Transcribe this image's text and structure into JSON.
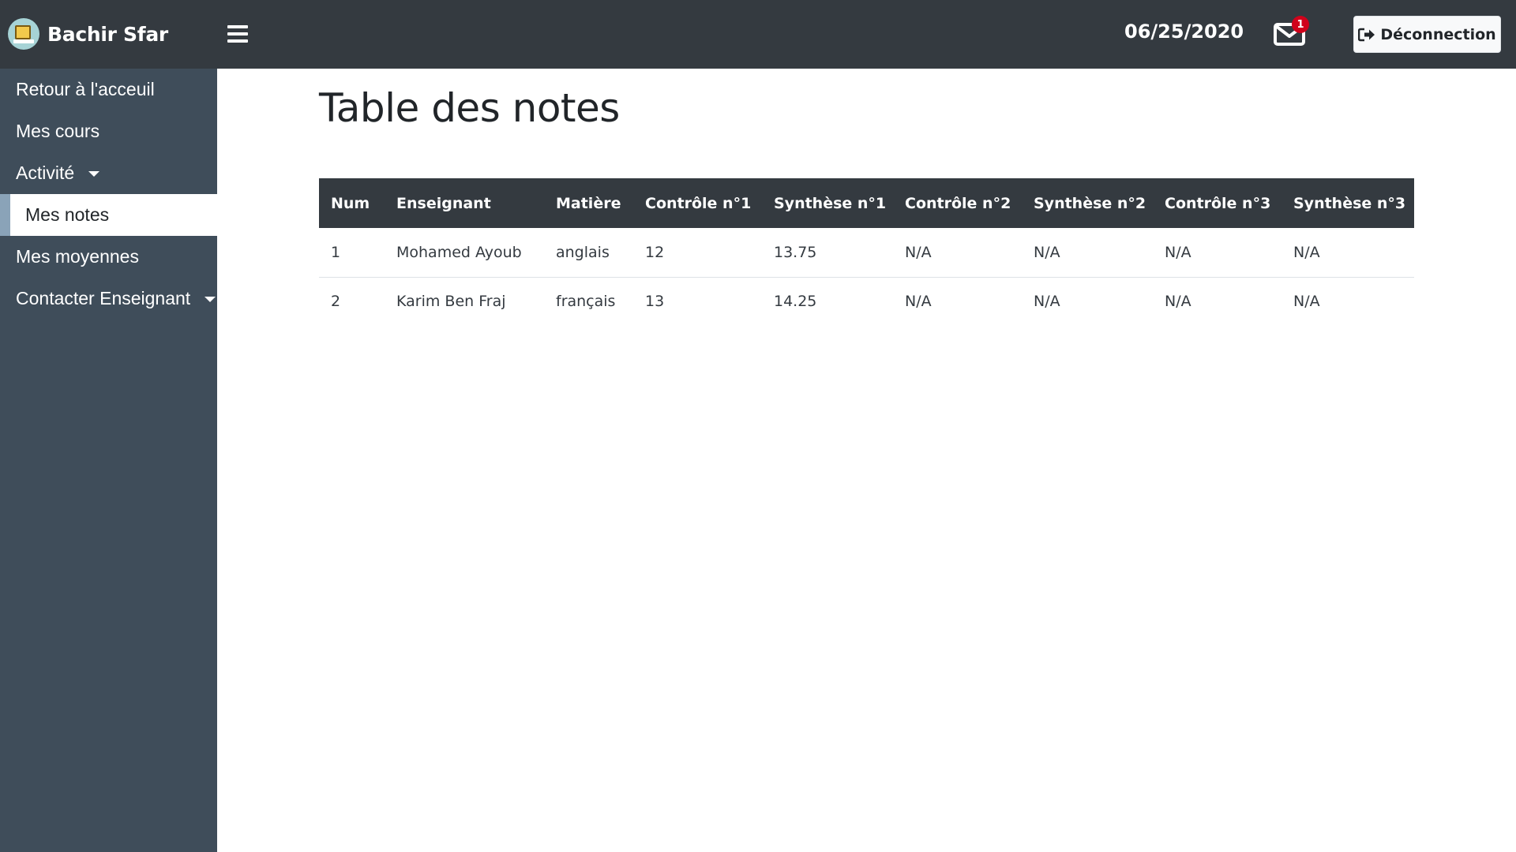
{
  "navbar": {
    "brand_name": "Bachir Sfar",
    "date": "06/25/2020",
    "unread_count": "1",
    "logout_label": "Déconnection"
  },
  "sidebar": {
    "items": [
      {
        "label": "Retour à l'acceuil"
      },
      {
        "label": "Mes cours"
      },
      {
        "label": "Activité"
      },
      {
        "label": "Mes notes"
      },
      {
        "label": "Mes moyennes"
      },
      {
        "label": "Contacter Enseignant"
      }
    ]
  },
  "main": {
    "title": "Table des notes",
    "table": {
      "headers": [
        "Num",
        "Enseignant",
        "Matière",
        "Contrôle n°1",
        "Synthèse n°1",
        "Contrôle n°2",
        "Synthèse n°2",
        "Contrôle n°3",
        "Synthèse n°3"
      ],
      "rows": [
        [
          "1",
          "Mohamed Ayoub",
          "anglais",
          "12",
          "13.75",
          "N/A",
          "N/A",
          "N/A",
          "N/A"
        ],
        [
          "2",
          "Karim Ben Fraj",
          "français",
          "13",
          "14.25",
          "N/A",
          "N/A",
          "N/A",
          "N/A"
        ]
      ]
    }
  }
}
